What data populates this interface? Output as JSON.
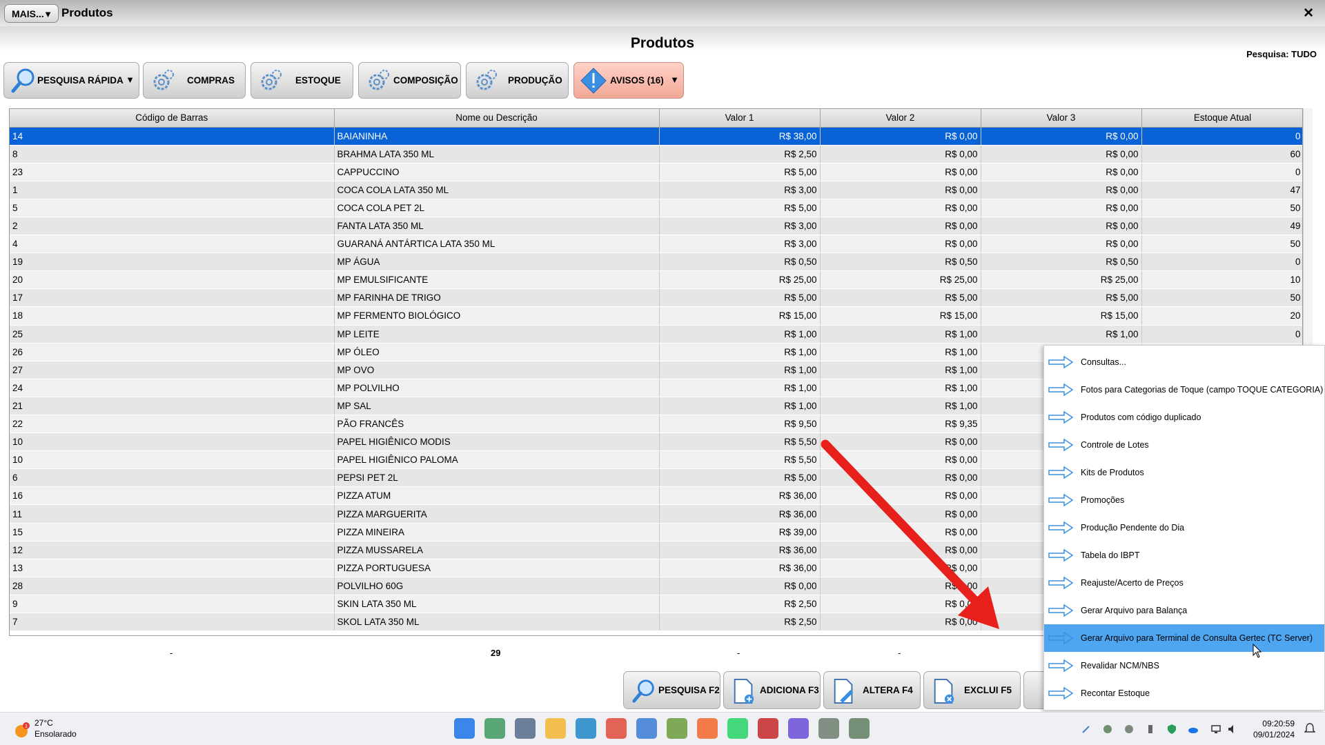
{
  "window": {
    "menu_button": "MAIS...",
    "title": "Produtos",
    "close": "✕"
  },
  "header": {
    "page_title": "Produtos",
    "search_mode": "Pesquisa: TUDO"
  },
  "toolbar": {
    "quick_search": "PESQUISA RÁPIDA",
    "purchases": "COMPRAS",
    "stock": "ESTOQUE",
    "composition": "COMPOSIÇÃO",
    "production": "PRODUÇÃO",
    "warnings": "AVISOS (16)"
  },
  "table": {
    "columns": [
      "Código de Barras",
      "Nome ou Descrição",
      "Valor 1",
      "Valor 2",
      "Valor 3",
      "Estoque Atual"
    ],
    "rows": [
      [
        "14",
        "BAIANINHA",
        "R$ 38,00",
        "R$ 0,00",
        "R$ 0,00",
        "0"
      ],
      [
        "8",
        "BRAHMA LATA 350 ML",
        "R$ 2,50",
        "R$ 0,00",
        "R$ 0,00",
        "60"
      ],
      [
        "23",
        "CAPPUCCINO",
        "R$ 5,00",
        "R$ 0,00",
        "R$ 0,00",
        "0"
      ],
      [
        "1",
        "COCA COLA LATA 350 ML",
        "R$ 3,00",
        "R$ 0,00",
        "R$ 0,00",
        "47"
      ],
      [
        "5",
        "COCA COLA PET 2L",
        "R$ 5,00",
        "R$ 0,00",
        "R$ 0,00",
        "50"
      ],
      [
        "2",
        "FANTA LATA 350 ML",
        "R$ 3,00",
        "R$ 0,00",
        "R$ 0,00",
        "49"
      ],
      [
        "4",
        "GUARANÁ ANTÁRTICA LATA 350 ML",
        "R$ 3,00",
        "R$ 0,00",
        "R$ 0,00",
        "50"
      ],
      [
        "19",
        "MP ÁGUA",
        "R$ 0,50",
        "R$ 0,50",
        "R$ 0,50",
        "0"
      ],
      [
        "20",
        "MP EMULSIFICANTE",
        "R$ 25,00",
        "R$ 25,00",
        "R$ 25,00",
        "10"
      ],
      [
        "17",
        "MP FARINHA DE TRIGO",
        "R$ 5,00",
        "R$ 5,00",
        "R$ 5,00",
        "50"
      ],
      [
        "18",
        "MP FERMENTO BIOLÓGICO",
        "R$ 15,00",
        "R$ 15,00",
        "R$ 15,00",
        "20"
      ],
      [
        "25",
        "MP LEITE",
        "R$ 1,00",
        "R$ 1,00",
        "R$ 1,00",
        "0"
      ],
      [
        "26",
        "MP ÓLEO",
        "R$ 1,00",
        "R$ 1,00",
        "",
        ""
      ],
      [
        "27",
        "MP OVO",
        "R$ 1,00",
        "R$ 1,00",
        "",
        ""
      ],
      [
        "24",
        "MP POLVILHO",
        "R$ 1,00",
        "R$ 1,00",
        "",
        ""
      ],
      [
        "21",
        "MP SAL",
        "R$ 1,00",
        "R$ 1,00",
        "",
        ""
      ],
      [
        "22",
        "PÃO FRANCÊS",
        "R$ 9,50",
        "R$ 9,35",
        "",
        ""
      ],
      [
        "10",
        "PAPEL HIGIÊNICO MODIS",
        "R$ 5,50",
        "R$ 0,00",
        "",
        ""
      ],
      [
        "10",
        "PAPEL HIGIÊNICO PALOMA",
        "R$ 5,50",
        "R$ 0,00",
        "",
        ""
      ],
      [
        "6",
        "PEPSI PET 2L",
        "R$ 5,00",
        "R$ 0,00",
        "",
        ""
      ],
      [
        "16",
        "PIZZA ATUM",
        "R$ 36,00",
        "R$ 0,00",
        "",
        ""
      ],
      [
        "11",
        "PIZZA MARGUERITA",
        "R$ 36,00",
        "R$ 0,00",
        "",
        ""
      ],
      [
        "15",
        "PIZZA MINEIRA",
        "R$ 39,00",
        "R$ 0,00",
        "",
        ""
      ],
      [
        "12",
        "PIZZA MUSSARELA",
        "R$ 36,00",
        "R$ 0,00",
        "",
        ""
      ],
      [
        "13",
        "PIZZA PORTUGUESA",
        "R$ 36,00",
        "R$ 0,00",
        "",
        ""
      ],
      [
        "28",
        "POLVILHO 60G",
        "R$ 0,00",
        "R$ 0,00",
        "",
        ""
      ],
      [
        "9",
        "SKIN LATA 350 ML",
        "R$ 2,50",
        "R$ 0,00",
        "",
        ""
      ],
      [
        "7",
        "SKOL LATA 350 ML",
        "R$ 2,50",
        "R$ 0,00",
        "",
        ""
      ]
    ]
  },
  "footer": {
    "totals": [
      "-",
      "29",
      "-",
      "-"
    ]
  },
  "bottom_buttons": {
    "search": "PESQUISA F2",
    "add": "ADICIONA F3",
    "edit": "ALTERA F4",
    "delete": "EXCLUI F5"
  },
  "context_menu": {
    "items": [
      "Consultas...",
      "Fotos para Categorias de Toque (campo TOQUE CATEGORIA)",
      "Produtos com código duplicado",
      "Controle de Lotes",
      "Kits de Produtos",
      "Promoções",
      "Produção Pendente do Dia",
      "Tabela do IBPT",
      "Reajuste/Acerto de Preços",
      "Gerar Arquivo para Balança",
      "Gerar Arquivo para Terminal de Consulta Gertec (TC Server)",
      "Revalidar NCM/NBS",
      "Recontar Estoque"
    ],
    "highlighted": "Gerar Arquivo para Terminal de Consulta Gertec (TC Server)"
  },
  "taskbar": {
    "weather_temp": "27°C",
    "weather_condition": "Ensolarado",
    "weather_badge": "1",
    "time": "09:20:59",
    "date": "09/01/2024",
    "apps": [
      "start-icon",
      "widgets-icon",
      "settings-icon",
      "file-explorer-icon",
      "edge-icon",
      "chrome-icon",
      "app-icon",
      "notepad-icon",
      "firefox-icon",
      "whatsapp-icon",
      "filezilla-icon",
      "video-icon",
      "app-s-icon",
      "app-s-active-icon"
    ]
  },
  "colors": {
    "selection": "#0a63d6",
    "menu_highlight": "#4ea5f0",
    "annotation_arrow": "#e8201c",
    "warning_button": "#f2a896"
  }
}
